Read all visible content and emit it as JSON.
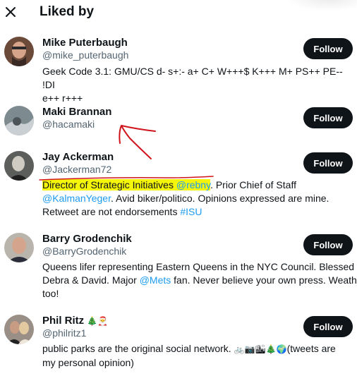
{
  "header": {
    "title": "Liked by",
    "close_icon": "close-icon"
  },
  "follow_label": "Follow",
  "users": [
    {
      "name": "Mike Puterbaugh",
      "handle": "@mike_puterbaugh",
      "bio_lines": [
        "Geek Code 3.1: GMU/CS d- s+:- a+ C+ W+++$ K+++ M+ PS++ PE-- !DI",
        "e++ r+++"
      ]
    },
    {
      "name": "Maki Brannan",
      "handle": "@hacamaki"
    },
    {
      "name": "Jay Ackerman",
      "handle": "@Jackerman72",
      "bio": {
        "highlight": "Director of Strategic Initiatives",
        "space1": " ",
        "mention1": "@rebny",
        "text1": ". Prior Chief of Staff",
        "mention2": "@KalmanYeger",
        "text2": ". Avid biker/politico. Opinions expressed are mine.",
        "text3": "Retweet are not endorsements ",
        "hashtag": "#ISU"
      }
    },
    {
      "name": "Barry Grodenchik",
      "handle": "@BarryGrodenchik",
      "bio": {
        "line1": "Queens lifer representing Eastern Queens in the NYC Council. Blessed w",
        "text1": "Debra & David. Major ",
        "mention1": "@Mets",
        "text2": " fan. Never believe your own press. Weather",
        "line3": "too!"
      }
    },
    {
      "name": "Phil Ritz",
      "name_emojis": "🎄🎅",
      "handle": "@philritz1",
      "bio": {
        "text1": "public parks are the original social network.",
        "emojis": "🚲📷🏙🎄🌍",
        "text2": "(tweets are",
        "line2": "my personal opinion)"
      }
    }
  ],
  "colors": {
    "text": "#0f1419",
    "secondary": "#536471",
    "link": "#1d9bf0",
    "highlight": "#f5f50a",
    "button": "#0f1419",
    "annotation": "#d0141c"
  }
}
